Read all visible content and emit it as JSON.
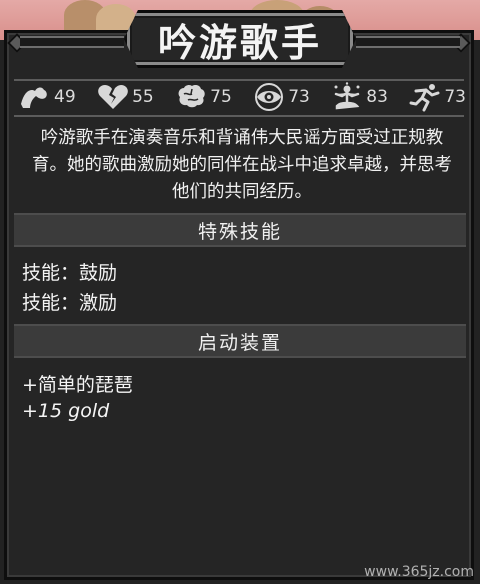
{
  "character": {
    "name": "吟游歌手",
    "description": "吟游歌手在演奏音乐和背诵伟大民谣方面受过正规教育。她的歌曲激励她的同伴在战斗中追求卓越，并思考他们的共同经历。"
  },
  "stats": [
    {
      "icon": "strength-icon",
      "value": "49"
    },
    {
      "icon": "broken-heart-icon",
      "value": "55"
    },
    {
      "icon": "brain-icon",
      "value": "75"
    },
    {
      "icon": "eye-icon",
      "value": "73"
    },
    {
      "icon": "meditation-icon",
      "value": "83"
    },
    {
      "icon": "running-icon",
      "value": "73"
    }
  ],
  "skills": {
    "header": "特殊技能",
    "items": [
      "技能：鼓励",
      "技能：激励"
    ]
  },
  "equipment": {
    "header": "启动装置",
    "items": [
      "+简单的琵琶",
      "+15 gold"
    ]
  },
  "watermark": "www.365jz.com",
  "colors": {
    "panel": "#252525",
    "section_header": "#3b3b3b",
    "text": "#f0f0f0",
    "sky": "#e4a9a6"
  }
}
